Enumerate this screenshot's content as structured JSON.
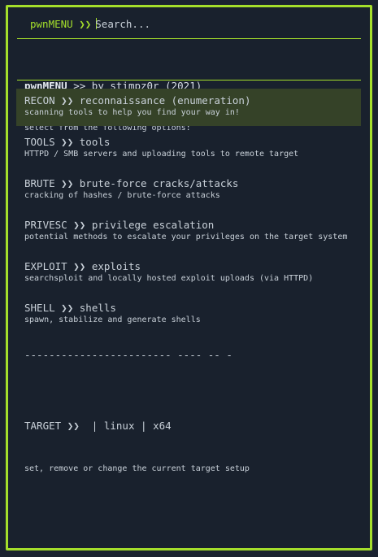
{
  "prompt": {
    "label": "pwnMENU",
    "arrow": "❯❯",
    "search_placeholder": "Search..."
  },
  "header": {
    "app_name": "pwnMENU",
    "byline": " >> by stimpz0r (2021)",
    "subtitle": "select from the following options:"
  },
  "menu": {
    "items": [
      {
        "key": "RECON",
        "title": "reconnaissance (enumeration)",
        "desc": "scanning tools to help you find your way in!",
        "selected": true
      },
      {
        "key": "TOOLS",
        "title": "tools",
        "desc": "HTTPD / SMB servers and uploading tools to remote target",
        "selected": false
      },
      {
        "key": "BRUTE",
        "title": "brute-force cracks/attacks",
        "desc": "cracking of hashes / brute-force attacks",
        "selected": false
      },
      {
        "key": "PRIVESC",
        "title": "privilege escalation",
        "desc": "potential methods to escalate your privileges on the target system",
        "selected": false
      },
      {
        "key": "EXPLOIT",
        "title": "exploits",
        "desc": "searchsploit and locally hosted exploit uploads (via HTTPD)",
        "selected": false
      },
      {
        "key": "SHELL",
        "title": "shells",
        "desc": "spawn, stabilize and generate shells",
        "selected": false
      }
    ]
  },
  "separator": "------------------------ ---- -- -",
  "target": {
    "key": "TARGET",
    "title": " | linux | x64",
    "desc": "set, remove or change the current target setup"
  },
  "colors": {
    "accent": "#a4de2b",
    "background": "#19212d",
    "selected_bg": "#354228",
    "text": "#c9d1d9"
  }
}
